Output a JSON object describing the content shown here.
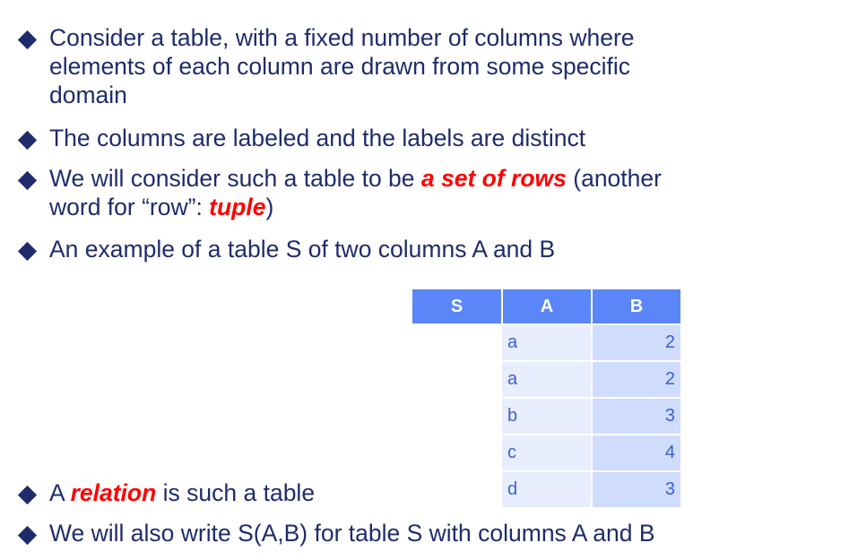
{
  "bullets": [
    {
      "lines": [
        "Consider a table, with a fixed number of columns where",
        "elements of each column are drawn from some specific",
        "domain"
      ]
    },
    {
      "text": "The columns are labeled and the labels are distinct"
    },
    {
      "before": "We will consider such a table to be ",
      "emphasis": "a set of rows",
      "after": " (another",
      "line2_before": "word for “row”: ",
      "line2_emphasis": "tuple",
      "line2_after": ")"
    },
    {
      "text": "An example of a table S of two columns A and B"
    },
    {
      "before": "A ",
      "emphasis": "relation",
      "after": " is such a table"
    },
    {
      "text": "We will also write S(A,B) for table S with columns A and B"
    }
  ],
  "table": {
    "headers": [
      "S",
      "A",
      "B"
    ],
    "rows": [
      {
        "a": "a",
        "b": "2"
      },
      {
        "a": "a",
        "b": "2"
      },
      {
        "a": "b",
        "b": "3"
      },
      {
        "a": "c",
        "b": "4"
      },
      {
        "a": "d",
        "b": "3"
      }
    ]
  },
  "colors": {
    "text": "#1f2c6b",
    "emphasis": "#ff0000",
    "header_bg": "#5b86f7",
    "col_a_bg": "#e8eefd",
    "col_b_bg": "#d0dcfb"
  }
}
